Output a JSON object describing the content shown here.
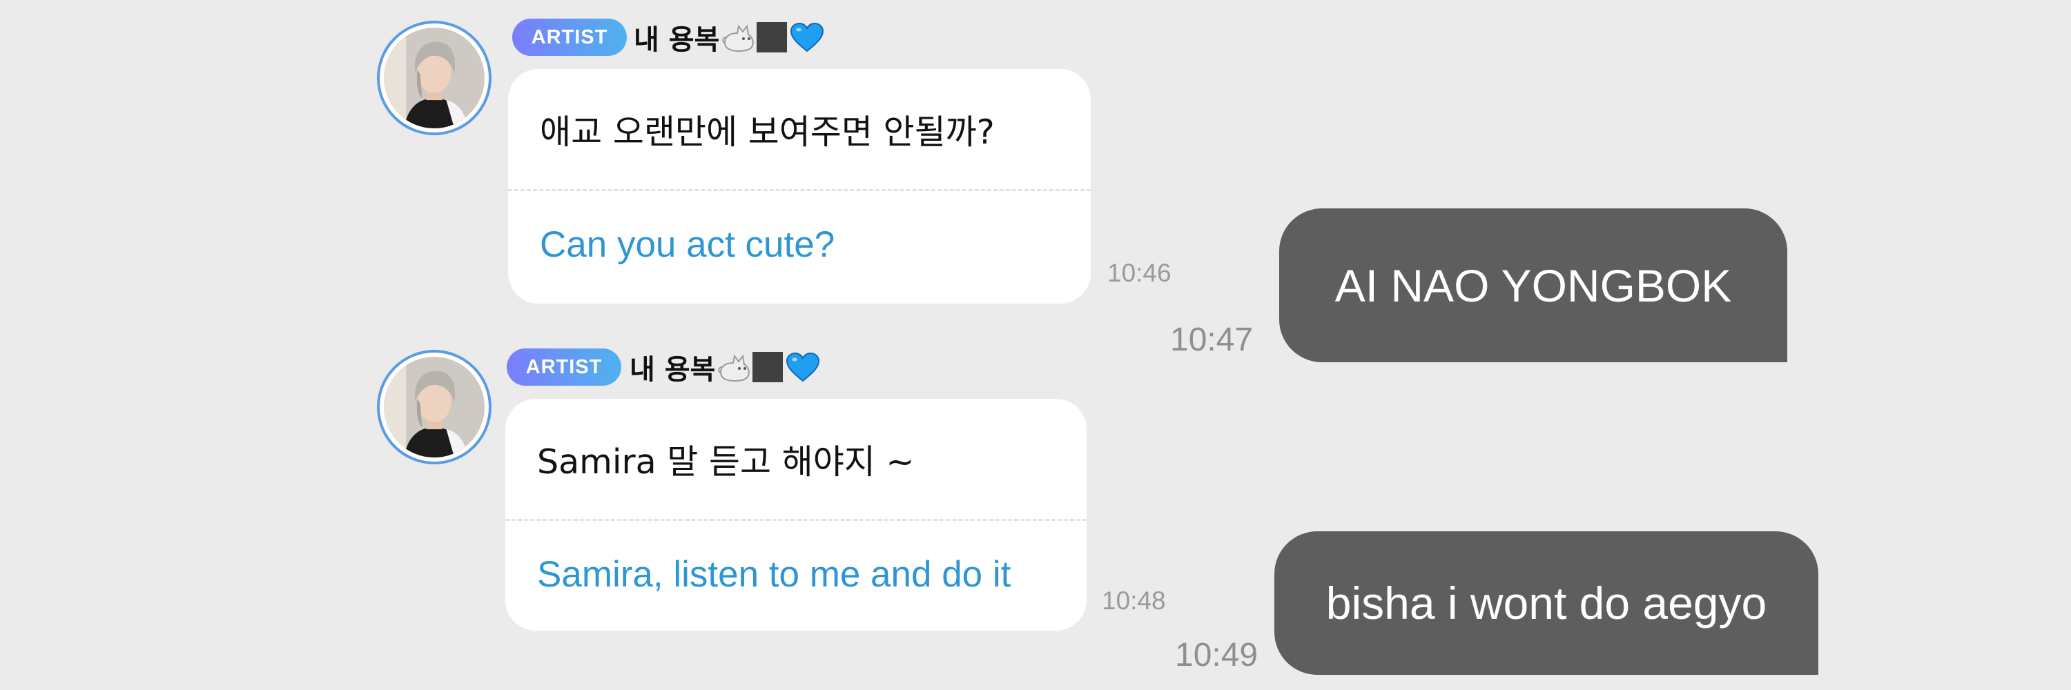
{
  "messages": [
    {
      "badge": "ARTIST",
      "sender_name": "내 용복",
      "sender_emojis": [
        "cat-icon",
        "black-square",
        "blue-heart-icon"
      ],
      "original_text": "애교 오랜만에 보여주면 안될까?",
      "translated_text": "Can you act cute?",
      "time": "10:46"
    },
    {
      "badge": "ARTIST",
      "sender_name": "내 용복",
      "sender_emojis": [
        "cat-icon",
        "black-square",
        "blue-heart-icon"
      ],
      "original_text": "Samira 말 듣고 해야지 ~",
      "translated_text": "Samira, listen to me and do it",
      "time": "10:48"
    }
  ],
  "replies": [
    {
      "text": "AI NAO YONGBOK",
      "time": "10:47"
    },
    {
      "text": "bisha i wont do aegyo",
      "time": "10:49"
    }
  ],
  "colors": {
    "background": "#ebebeb",
    "badge_gradient_start": "#7b7dfc",
    "badge_gradient_end": "#4fb3ee",
    "avatar_ring": "#5a9be6",
    "translation_text": "#2e96d2",
    "outgoing_bubble": "#5e5e5e",
    "timestamp": "#9a9a9a"
  }
}
